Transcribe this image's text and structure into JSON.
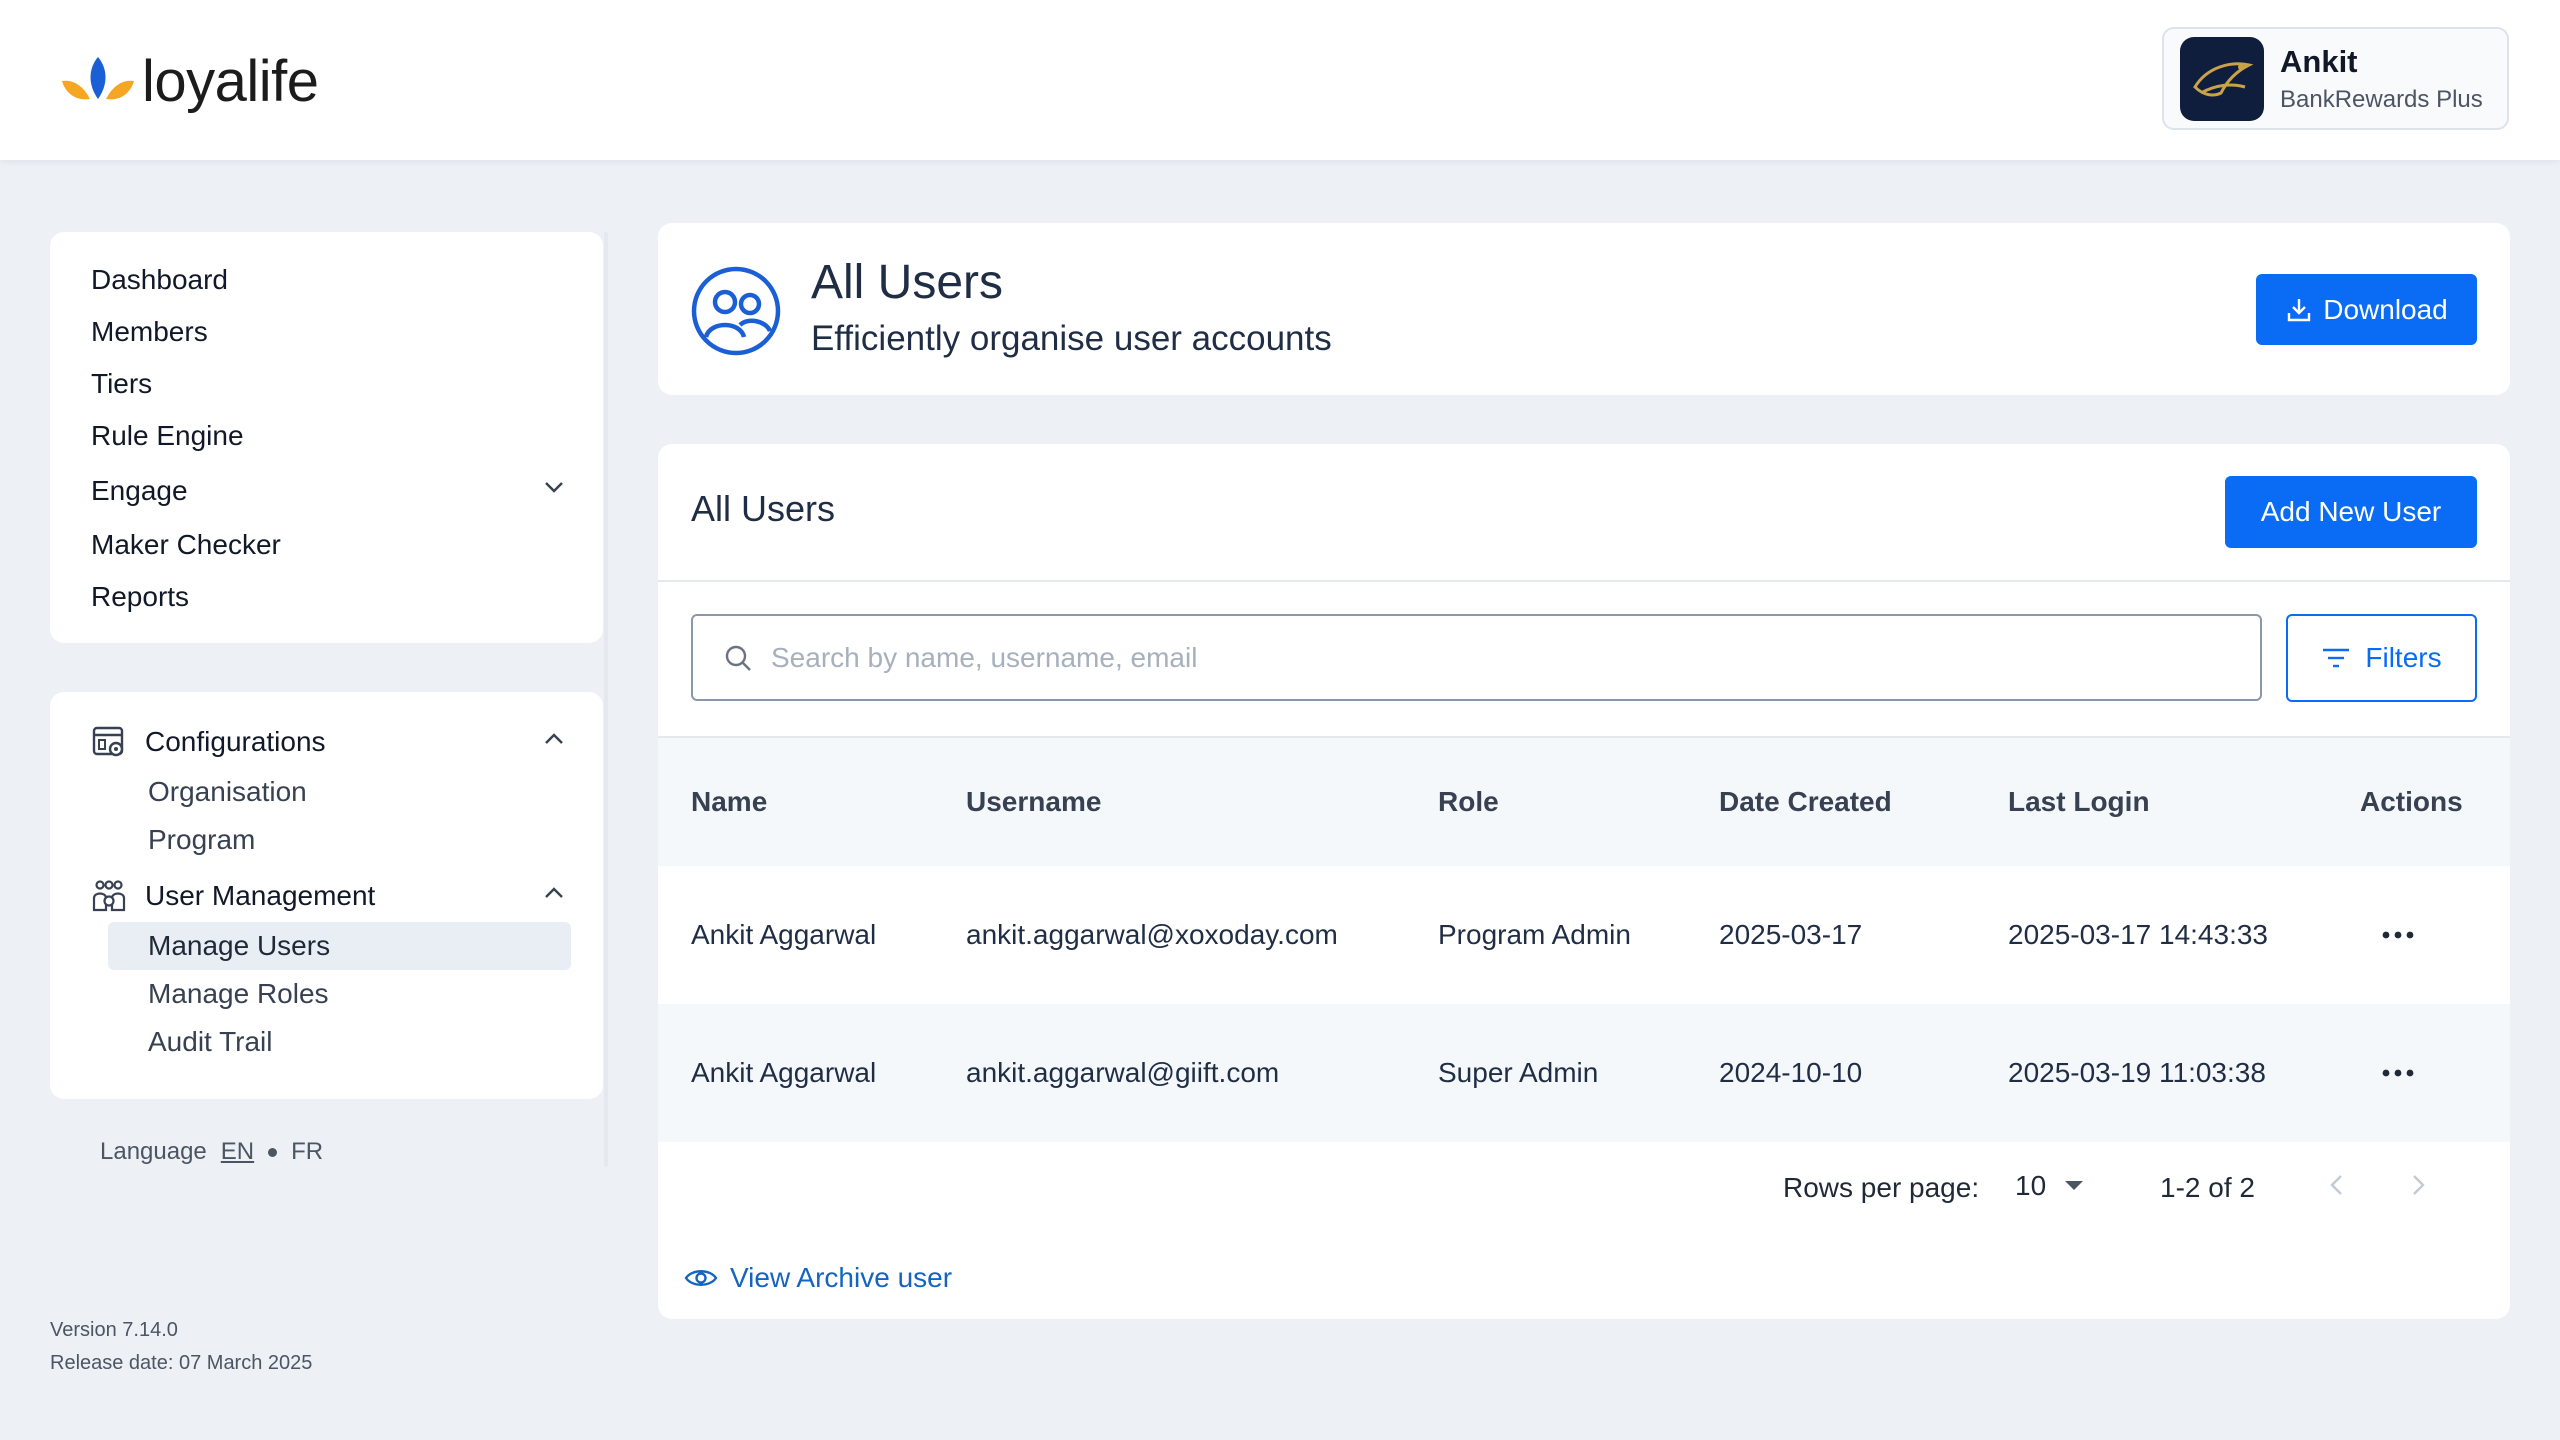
{
  "header": {
    "logo_text": "loyalife",
    "profile": {
      "name": "Ankit",
      "program": "BankRewards Plus"
    }
  },
  "sidebar": {
    "nav": [
      {
        "label": "Dashboard"
      },
      {
        "label": "Members"
      },
      {
        "label": "Tiers"
      },
      {
        "label": "Rule Engine"
      },
      {
        "label": "Engage"
      },
      {
        "label": "Maker Checker"
      },
      {
        "label": "Reports"
      }
    ],
    "configurations": {
      "label": "Configurations",
      "items": [
        {
          "label": "Organisation"
        },
        {
          "label": "Program"
        }
      ]
    },
    "user_management": {
      "label": "User Management",
      "items": [
        {
          "label": "Manage Users"
        },
        {
          "label": "Manage Roles"
        },
        {
          "label": "Audit Trail"
        }
      ],
      "active": "Manage Users"
    },
    "language": {
      "label": "Language",
      "en": "EN",
      "fr": "FR"
    },
    "version": "Version 7.14.0",
    "release_date": "Release date: 07 March 2025"
  },
  "page_header": {
    "title": "All Users",
    "subtitle": "Efficiently organise user accounts",
    "download_label": "Download"
  },
  "main": {
    "title": "All Users",
    "add_button": "Add New User",
    "search_placeholder": "Search by name, username, email",
    "filters_label": "Filters",
    "columns": [
      "Name",
      "Username",
      "Role",
      "Date Created",
      "Last Login",
      "Actions"
    ],
    "rows": [
      {
        "name": "Ankit Aggarwal",
        "username": "ankit.aggarwal@xoxoday.com",
        "role": "Program Admin",
        "date_created": "2025-03-17",
        "last_login": "2025-03-17 14:43:33"
      },
      {
        "name": "Ankit Aggarwal",
        "username": "ankit.aggarwal@giift.com",
        "role": "Super Admin",
        "date_created": "2024-10-10",
        "last_login": "2025-03-19 11:03:38"
      }
    ],
    "pagination": {
      "rows_per_page_label": "Rows per page:",
      "rows_per_page": "10",
      "range": "1-2 of 2"
    },
    "archive_link": "View Archive user"
  },
  "colors": {
    "primary": "#0a6cf5",
    "background": "#edf1f6",
    "logo_orange": "#f5a623",
    "logo_blue": "#1a5fd6"
  }
}
